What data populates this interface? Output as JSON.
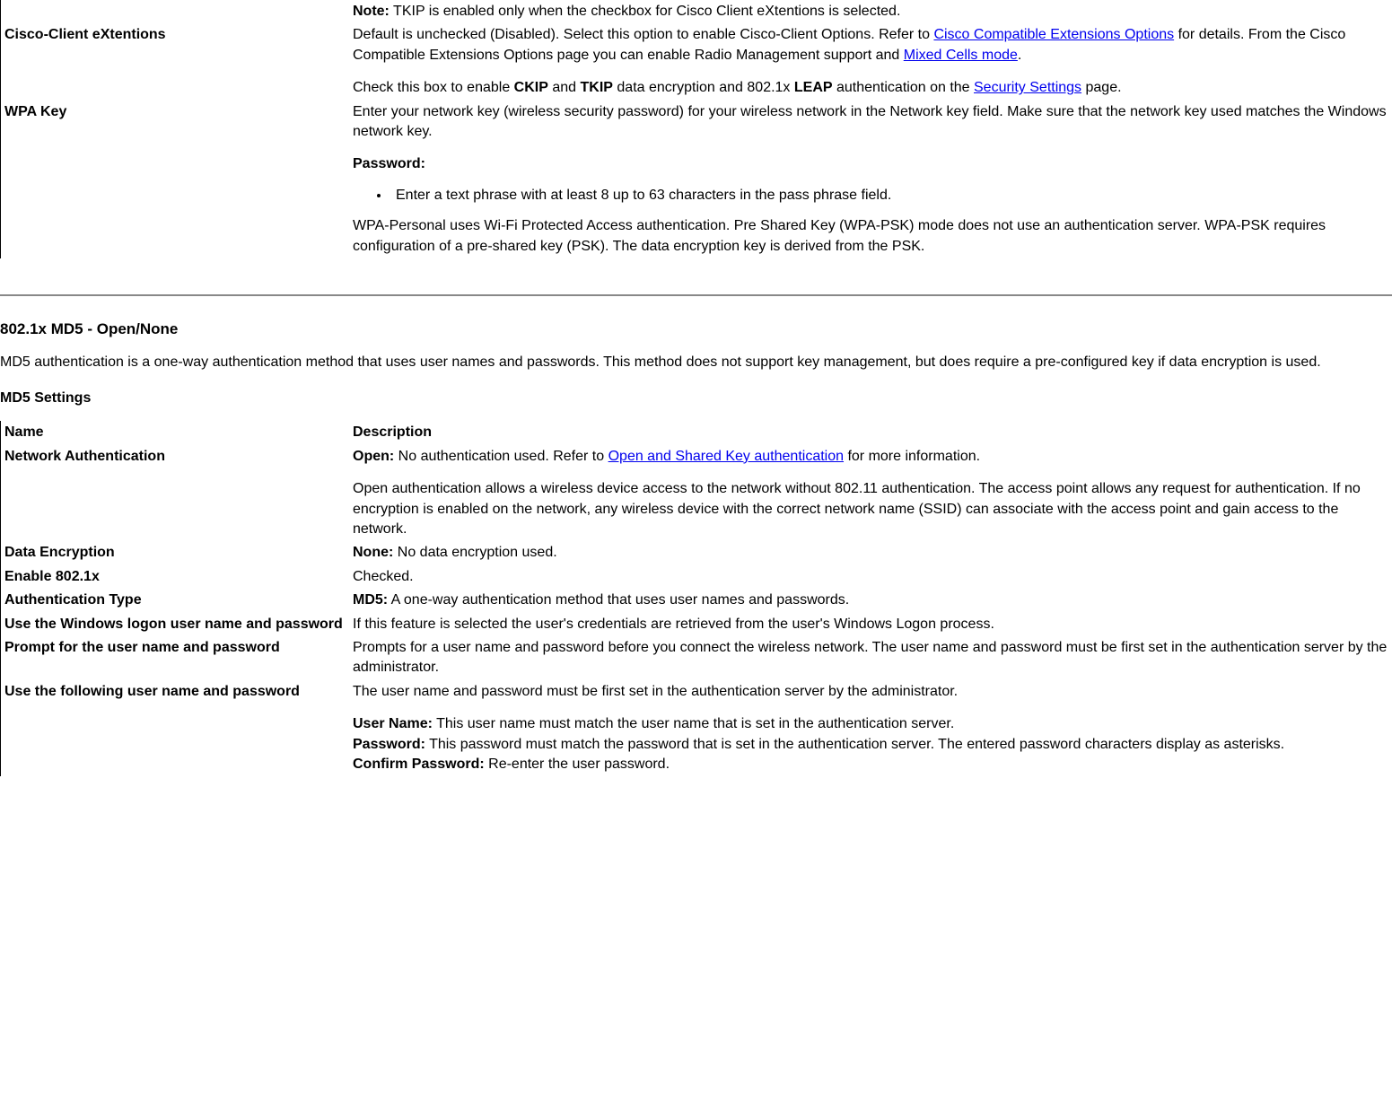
{
  "top_table": {
    "row_note": {
      "note_label": "Note:",
      "note_text": " TKIP is enabled only when the checkbox for Cisco Client eXtentions is selected."
    },
    "row_cisco": {
      "name": "Cisco-Client eXtentions",
      "text1": "Default is unchecked (Disabled). Select this option to enable Cisco-Client Options. Refer to ",
      "link1": "Cisco Compatible Extensions Options",
      "text2": " for details. From the Cisco Compatible Extensions Options page you can enable Radio Management support and ",
      "link2": "Mixed Cells mode",
      "text3": ".",
      "text4a": "Check this box to enable ",
      "ckip": "CKIP",
      "text4b": " and ",
      "tkip": "TKIP",
      "text4c": " data encryption and 802.1x ",
      "leap": "LEAP",
      "text4d": " authentication on the ",
      "link3": "Security Settings",
      "text4e": " page."
    },
    "row_wpa": {
      "name": "WPA Key",
      "text1": "Enter your network key (wireless security password) for your wireless network in the Network key field. Make sure that the network key used matches the Windows network key.",
      "password_label": "Password:",
      "bullet1": "Enter a text phrase with at least 8 up to 63 characters in the pass phrase field.",
      "text2": "WPA-Personal uses Wi-Fi Protected Access authentication. Pre Shared Key (WPA-PSK) mode does not use an authentication server. WPA-PSK requires configuration of a pre-shared key (PSK). The data encryption key is derived from the PSK."
    }
  },
  "section": {
    "heading": "802.1x MD5 - Open/None",
    "intro": "MD5 authentication is a one-way authentication method that uses user names and passwords. This method does not support key management, but does require a pre-configured key if data encryption is used.",
    "sub_heading": "MD5 Settings"
  },
  "md5_table": {
    "header": {
      "name": "Name",
      "desc": "Description"
    },
    "row_netauth": {
      "name": "Network Authentication",
      "open_label": "Open:",
      "text1": " No authentication used. Refer to ",
      "link1": "Open and Shared Key authentication",
      "text2": " for more information.",
      "para2": "Open authentication allows a wireless device access to the network without 802.11 authentication. The access point allows any request for authentication. If no encryption is enabled on the network, any wireless device with the correct network name (SSID) can associate with the access point and gain access to the network."
    },
    "row_dataenc": {
      "name": "Data Encryption",
      "none_label": "None:",
      "text": " No data encryption used."
    },
    "row_enable": {
      "name": "Enable 802.1x",
      "text": "Checked."
    },
    "row_authtype": {
      "name": "Authentication Type",
      "md5_label": "MD5:",
      "text": " A one-way authentication method that uses user names and passwords."
    },
    "row_winlogon": {
      "name": "Use the Windows logon user name and password",
      "text": "If this feature is selected the user's credentials are retrieved from the user's Windows Logon process."
    },
    "row_prompt": {
      "name": "Prompt for the user name and password",
      "text": "Prompts for a user name and password before you connect the wireless network. The user name and password must be first set in the authentication server by the administrator."
    },
    "row_following": {
      "name": "Use the following user name and password",
      "text1": "The user name and password must be first set in the authentication server by the administrator.",
      "user_label": "User Name:",
      "user_text": " This user name must match the user name that is set in the authentication server.",
      "pass_label": "Password:",
      "pass_text": " This password must match the password that is set in the authentication server. The entered password characters display as asterisks.",
      "confirm_label": "Confirm Password:",
      "confirm_text": " Re-enter the user password."
    }
  }
}
